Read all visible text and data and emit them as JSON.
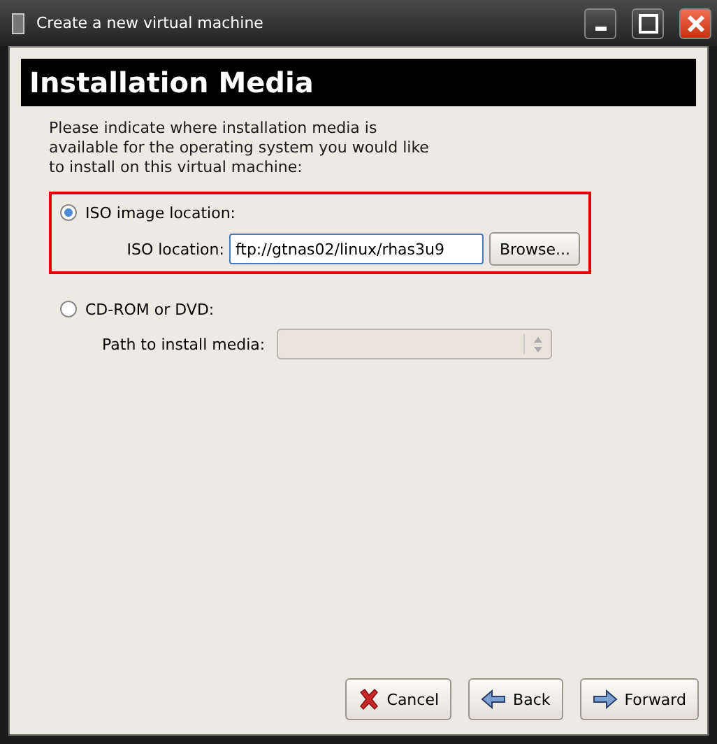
{
  "window": {
    "title": "Create a new virtual machine"
  },
  "header": {
    "title": "Installation Media"
  },
  "description": "Please indicate where installation media is available for the operating system you would like to install on this virtual machine:",
  "options": [
    {
      "kind": "iso",
      "label": "ISO image location:",
      "selected": true,
      "highlighted": true,
      "field_label": "ISO location:",
      "value": "ftp://gtnas02/linux/rhas3u9",
      "button": "Browse..."
    },
    {
      "kind": "cdrom",
      "label": "CD-ROM or DVD:",
      "selected": false,
      "highlighted": false,
      "field_label": "Path to install media:",
      "disabled": true
    }
  ],
  "buttons": [
    {
      "kind": "cancel",
      "label": "Cancel"
    },
    {
      "kind": "back",
      "label": "Back"
    },
    {
      "kind": "forward",
      "label": "Forward"
    }
  ]
}
